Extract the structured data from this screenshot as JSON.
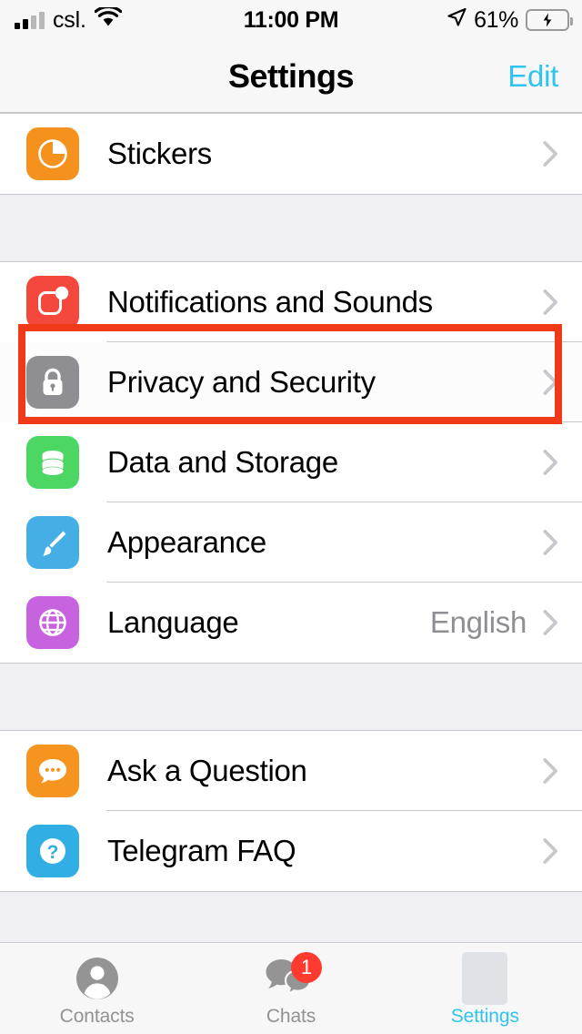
{
  "status_bar": {
    "carrier": "csl.",
    "time": "11:00 PM",
    "battery_percent": "61%",
    "battery_level": 61,
    "charging": true,
    "signal_bars_filled": 2,
    "signal_bars_total": 4,
    "wifi": true,
    "location_arrow": true
  },
  "nav": {
    "title": "Settings",
    "edit_label": "Edit"
  },
  "sections": [
    {
      "id": "stickers-section",
      "rows": [
        {
          "id": "stickers",
          "label": "Stickers",
          "icon": "sticker-icon",
          "color": "#F5921E",
          "value": "",
          "highlighted": false
        }
      ]
    },
    {
      "id": "main-settings-section",
      "rows": [
        {
          "id": "notifications",
          "label": "Notifications and Sounds",
          "icon": "notification-bubble-icon",
          "color": "#F4483C",
          "value": "",
          "highlighted": false
        },
        {
          "id": "privacy",
          "label": "Privacy and Security",
          "icon": "lock-icon",
          "color": "#8E8E93",
          "value": "",
          "highlighted": true
        },
        {
          "id": "data-storage",
          "label": "Data and Storage",
          "icon": "database-icon",
          "color": "#4CD662",
          "value": "",
          "highlighted": false
        },
        {
          "id": "appearance",
          "label": "Appearance",
          "icon": "paintbrush-icon",
          "color": "#45AEE4",
          "value": "",
          "highlighted": false
        },
        {
          "id": "language",
          "label": "Language",
          "icon": "globe-icon",
          "color": "#C863E0",
          "value": "English",
          "highlighted": false
        }
      ]
    },
    {
      "id": "help-section",
      "rows": [
        {
          "id": "ask-question",
          "label": "Ask a Question",
          "icon": "chat-dots-icon",
          "color": "#F5951F",
          "value": "",
          "highlighted": false
        },
        {
          "id": "telegram-faq",
          "label": "Telegram FAQ",
          "icon": "question-circle-icon",
          "color": "#31AEE4",
          "value": "",
          "highlighted": false
        }
      ]
    }
  ],
  "annotation": {
    "target": "privacy",
    "color": "#F03A17",
    "shape": "rectangle"
  },
  "tab_bar": {
    "tabs": [
      {
        "id": "contacts",
        "label": "Contacts",
        "icon": "person-circle-icon",
        "active": false,
        "badge": ""
      },
      {
        "id": "chats",
        "label": "Chats",
        "icon": "chat-bubbles-icon",
        "active": false,
        "badge": "1"
      },
      {
        "id": "settings",
        "label": "Settings",
        "icon": "settings-placeholder-icon",
        "active": true,
        "badge": ""
      }
    ]
  },
  "colors": {
    "accent": "#2FC3F0",
    "separator": "#C8C7CC",
    "group_background": "#EFEFF4",
    "row_background": "#FFFFFF",
    "secondary_text": "#8E8E93",
    "badge_red": "#FF3B30",
    "battery_green": "#34C759",
    "annotation_red": "#F03A17"
  }
}
